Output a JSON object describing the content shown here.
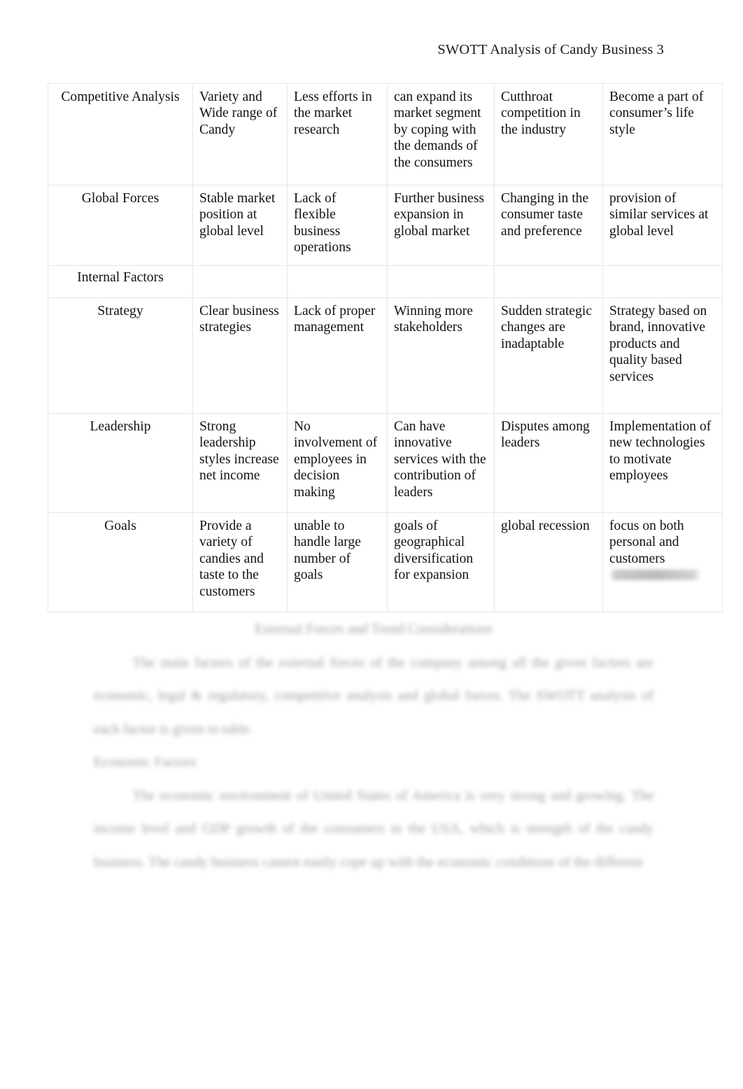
{
  "document": {
    "running_header": "SWOTT Analysis of Candy Business 3"
  },
  "table": {
    "rows": [
      {
        "type": "data",
        "label": "Competitive Analysis",
        "cells": [
          "Variety and Wide range of Candy",
          "Less efforts in the market research",
          "can expand its market segment by coping with the demands of the consumers",
          "Cutthroat competition in the industry",
          "Become a part of consumer’s life style"
        ]
      },
      {
        "type": "data",
        "label": "Global Forces",
        "cells": [
          "Stable market position at global level",
          "Lack of flexible business operations",
          "Further business expansion in global market",
          "Changing in the consumer taste and preference",
          "provision of similar services at global level"
        ]
      },
      {
        "type": "section",
        "label": "Internal Factors",
        "cells": [
          "",
          "",
          "",
          "",
          ""
        ]
      },
      {
        "type": "data",
        "label": "Strategy",
        "cells": [
          "Clear business strategies",
          "Lack of proper management",
          "Winning more stakeholders",
          "Sudden strategic changes are inadaptable",
          "Strategy based on brand, innovative products and quality based services"
        ]
      },
      {
        "type": "data",
        "label": "Leadership",
        "cells": [
          "Strong leadership styles increase net income",
          "No involvement of employees in decision making",
          "Can have innovative services with the contribution of leaders",
          "Disputes among leaders",
          "Implementation of new technologies to motivate employees"
        ]
      },
      {
        "type": "data",
        "label": "Goals",
        "cells": [
          "Provide a variety of candies and taste to the customers",
          "unable to handle large number of goals",
          "goals of geographical diversification for expansion",
          "global recession",
          "focus on both personal and customers"
        ],
        "last_cell_redacted_line": "████████████"
      }
    ]
  },
  "body": {
    "section_heading": "External Forces and Trend Considerations",
    "paragraph_1": "The main factors of the external forces of the company among all the given factors are economic, legal & regulatory, competitive analysis and global forces. The SWOTT analysis of each factor is given in table.",
    "subheading": "Economic Factors",
    "paragraph_2": "The economic environment of United States of America is very strong and growing. The income level and GDP growth of the consumers in the USA, which is strength of the candy business. The candy business cannot easily cope up with the economic conditions of the different"
  }
}
